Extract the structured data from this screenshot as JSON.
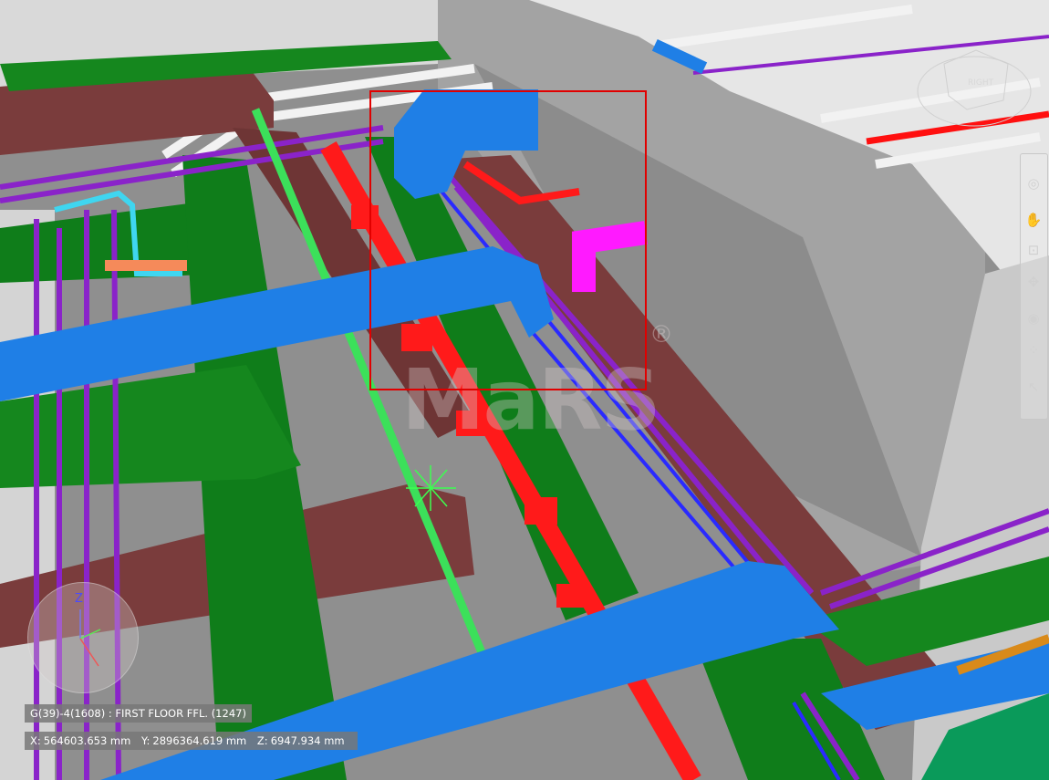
{
  "viewport": {
    "watermark": "MaRS",
    "registered_mark": "®",
    "view_cube_label": "RIGHT"
  },
  "nav_bar": {
    "tools": [
      {
        "name": "look-icon",
        "glyph": "◎"
      },
      {
        "name": "pan-icon",
        "glyph": "✋"
      },
      {
        "name": "zoom-window-icon",
        "glyph": "⊡"
      },
      {
        "name": "orbit-icon",
        "glyph": "✥"
      },
      {
        "name": "camera-icon",
        "glyph": "◉"
      },
      {
        "name": "walk-icon",
        "glyph": "⁘"
      },
      {
        "name": "select-icon",
        "glyph": "↖"
      }
    ]
  },
  "compass": {
    "axis_label": "Z"
  },
  "status": {
    "level": "G(39)-4(1608) : FIRST FLOOR FFL. (1247)",
    "x_label": "X:",
    "x_value": "564603.653 mm",
    "y_label": "Y:",
    "y_value": "2896364.619 mm",
    "z_label": "Z:",
    "z_value": "6947.934 mm"
  },
  "colors": {
    "duct_blue": "#1f7fe6",
    "pipe_red": "#ff1a1a",
    "tray_green": "#0f7d1a",
    "beam_brown": "#7a3c3c",
    "conduit_purple": "#8a23c9",
    "pipe_magenta": "#ff1aff",
    "pipe_lime": "#3ce05a",
    "pipe_cyan": "#3fd6f0",
    "wall_grey": "#a8a8a8",
    "selection_red": "#e10000"
  }
}
